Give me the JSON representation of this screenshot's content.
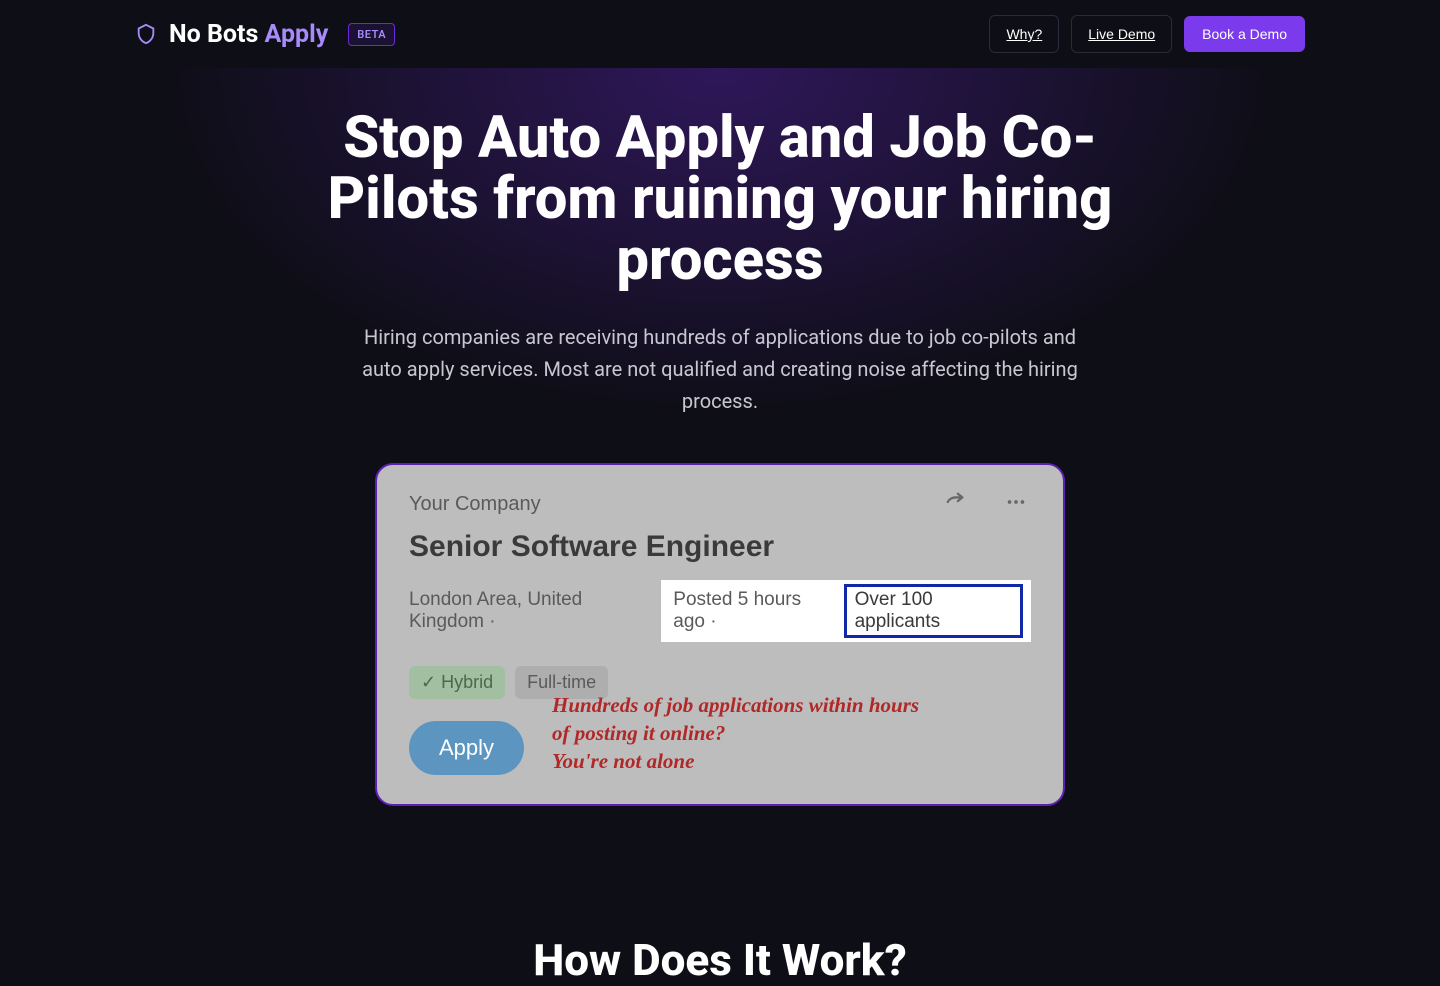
{
  "header": {
    "brand_prefix": "No Bots ",
    "brand_accent": "Apply",
    "beta": "BETA",
    "links": {
      "why": "Why?",
      "live_demo": "Live Demo",
      "book_demo": "Book a Demo"
    }
  },
  "hero": {
    "title": "Stop Auto Apply and Job Co-Pilots from ruining your hiring process",
    "sub": "Hiring companies are receiving hundreds of applications due to job co-pilots and auto apply services. Most are not qualified and creating noise affecting the hiring process."
  },
  "card": {
    "company": "Your Company",
    "title": "Senior Software Engineer",
    "location": "London Area, United Kingdom · ",
    "posted": "Posted 5 hours ago · ",
    "applicants": "Over 100 applicants",
    "badge_hybrid": "Hybrid",
    "badge_fulltime": "Full-time",
    "apply": "Apply",
    "callout_line1": "Hundreds of job applications within hours of posting it online?",
    "callout_line2": "You're not alone"
  },
  "next": {
    "heading": "How Does It Work?"
  }
}
